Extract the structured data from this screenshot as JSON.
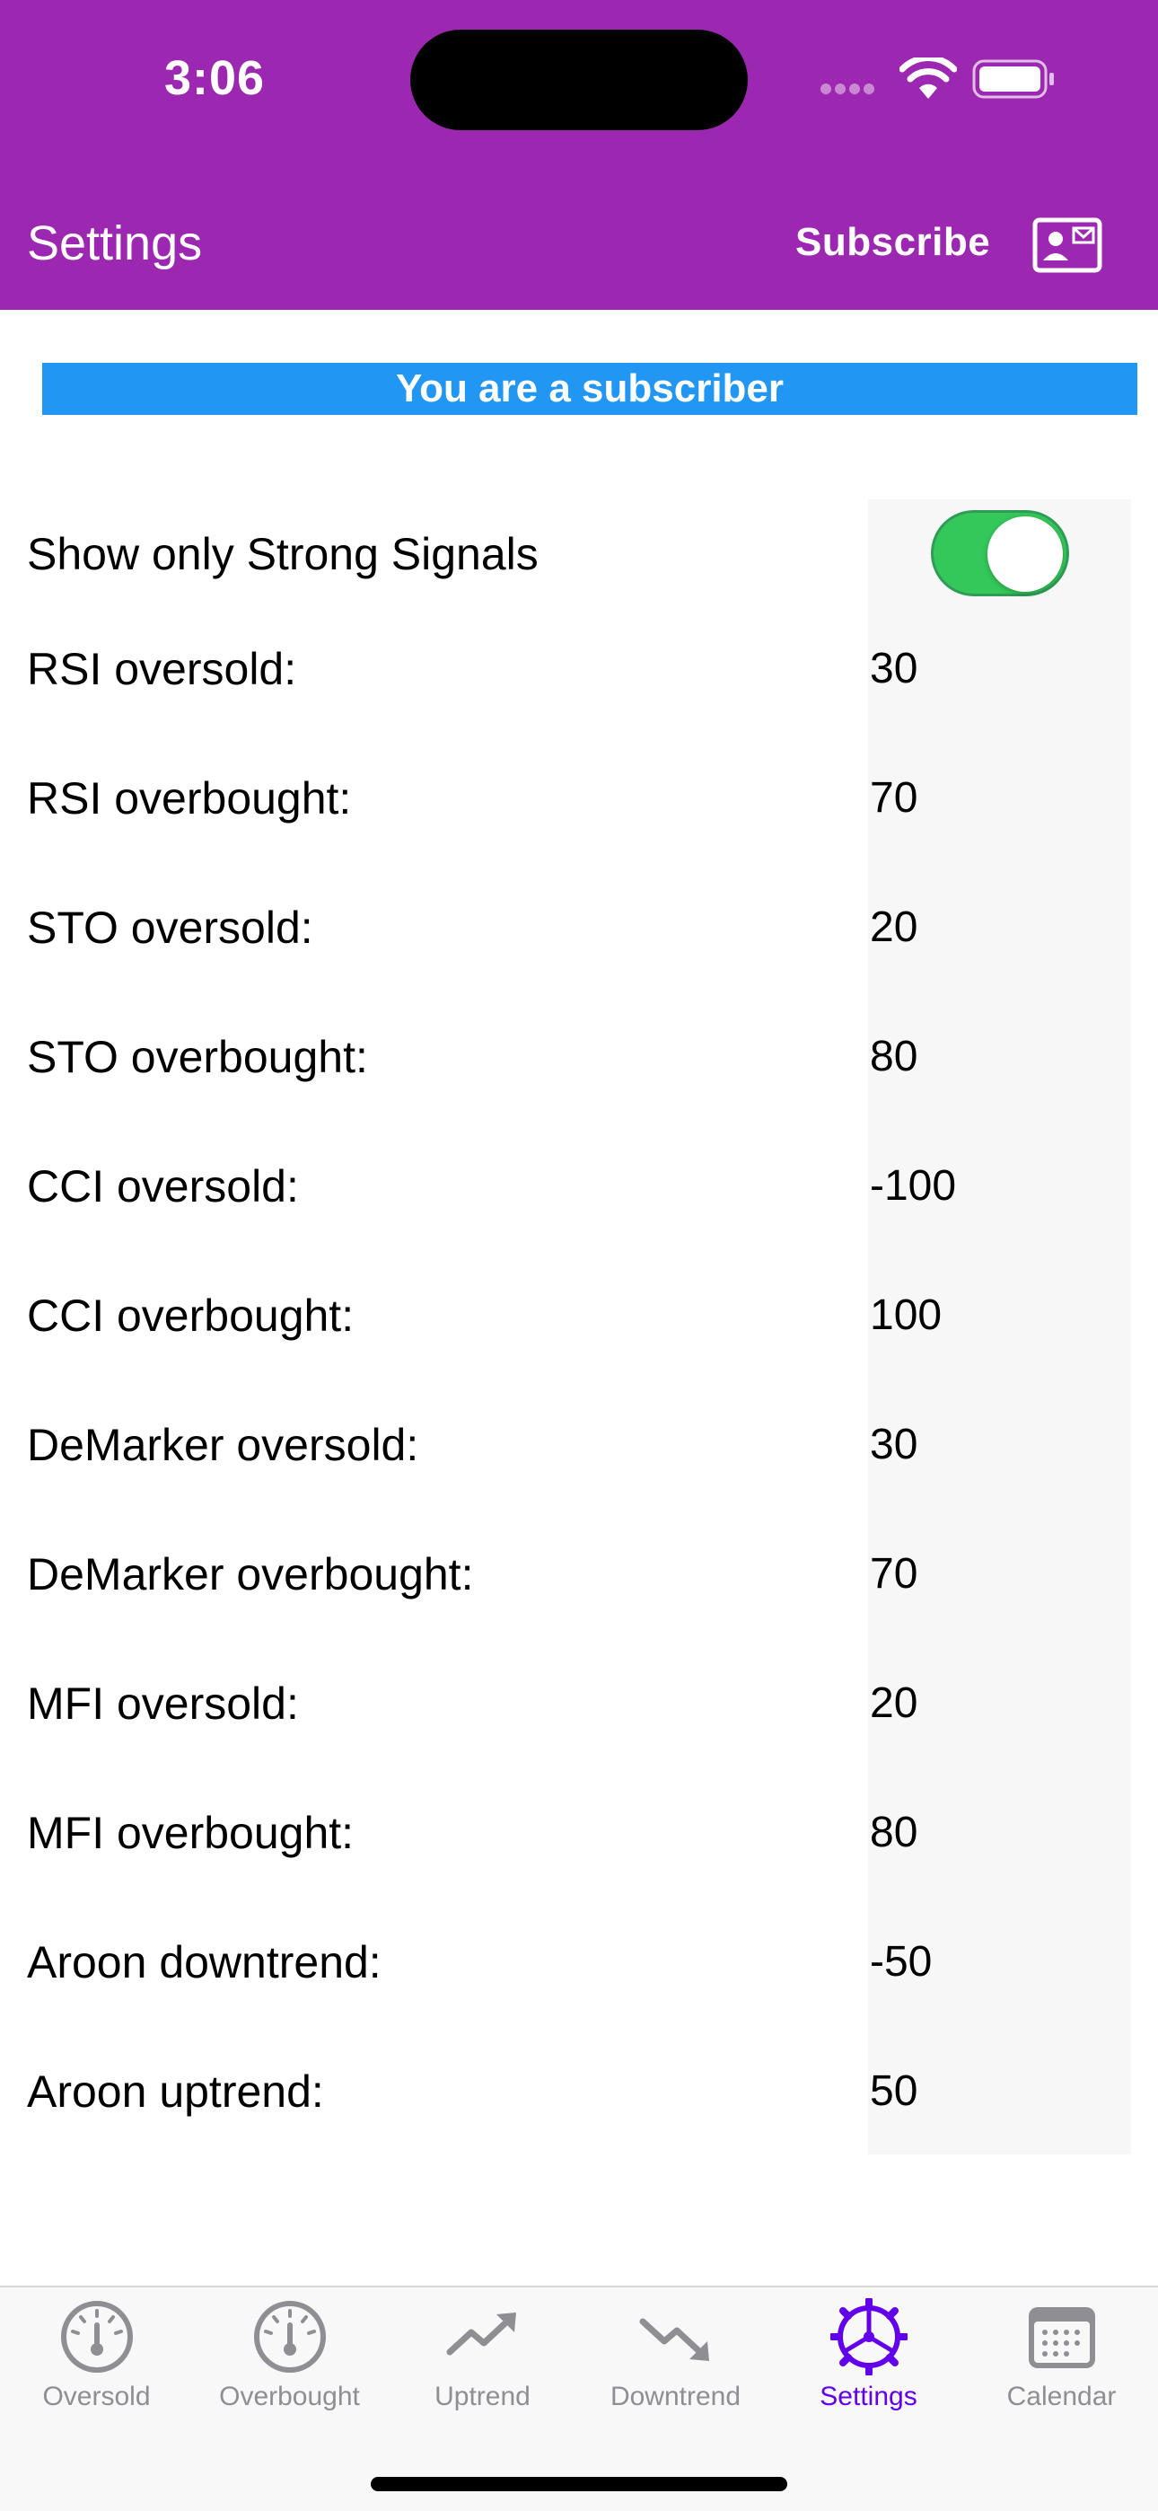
{
  "status_bar": {
    "time": "3:06"
  },
  "header": {
    "title": "Settings",
    "subscribe_label": "Subscribe"
  },
  "banner": {
    "text": "You are a subscriber",
    "color": "#2196f3"
  },
  "toggle": {
    "label": "Show only Strong Signals",
    "on": true,
    "color": "#34c759"
  },
  "settings": [
    {
      "label": "RSI oversold:",
      "value": "30"
    },
    {
      "label": "RSI overbought:",
      "value": "70"
    },
    {
      "label": "STO oversold:",
      "value": "20"
    },
    {
      "label": "STO overbought:",
      "value": "80"
    },
    {
      "label": "CCI oversold:",
      "value": "-100"
    },
    {
      "label": "CCI overbought:",
      "value": "100"
    },
    {
      "label": "DeMarker oversold:",
      "value": "30"
    },
    {
      "label": "DeMarker overbought:",
      "value": "70"
    },
    {
      "label": "MFI oversold:",
      "value": "20"
    },
    {
      "label": "MFI overbought:",
      "value": "80"
    },
    {
      "label": "Aroon downtrend:",
      "value": "-50"
    },
    {
      "label": "Aroon uptrend:",
      "value": "50"
    }
  ],
  "tabs": [
    {
      "label": "Oversold",
      "icon": "gauge-icon"
    },
    {
      "label": "Overbought",
      "icon": "gauge-icon"
    },
    {
      "label": "Uptrend",
      "icon": "trend-up-icon"
    },
    {
      "label": "Downtrend",
      "icon": "trend-down-icon"
    },
    {
      "label": "Settings",
      "icon": "settings-gear-icon",
      "active": true
    },
    {
      "label": "Calendar",
      "icon": "calendar-icon"
    }
  ],
  "colors": {
    "header": "#9c27b0",
    "active_tab": "#6200ea",
    "inactive_tab": "#8e8e93"
  }
}
